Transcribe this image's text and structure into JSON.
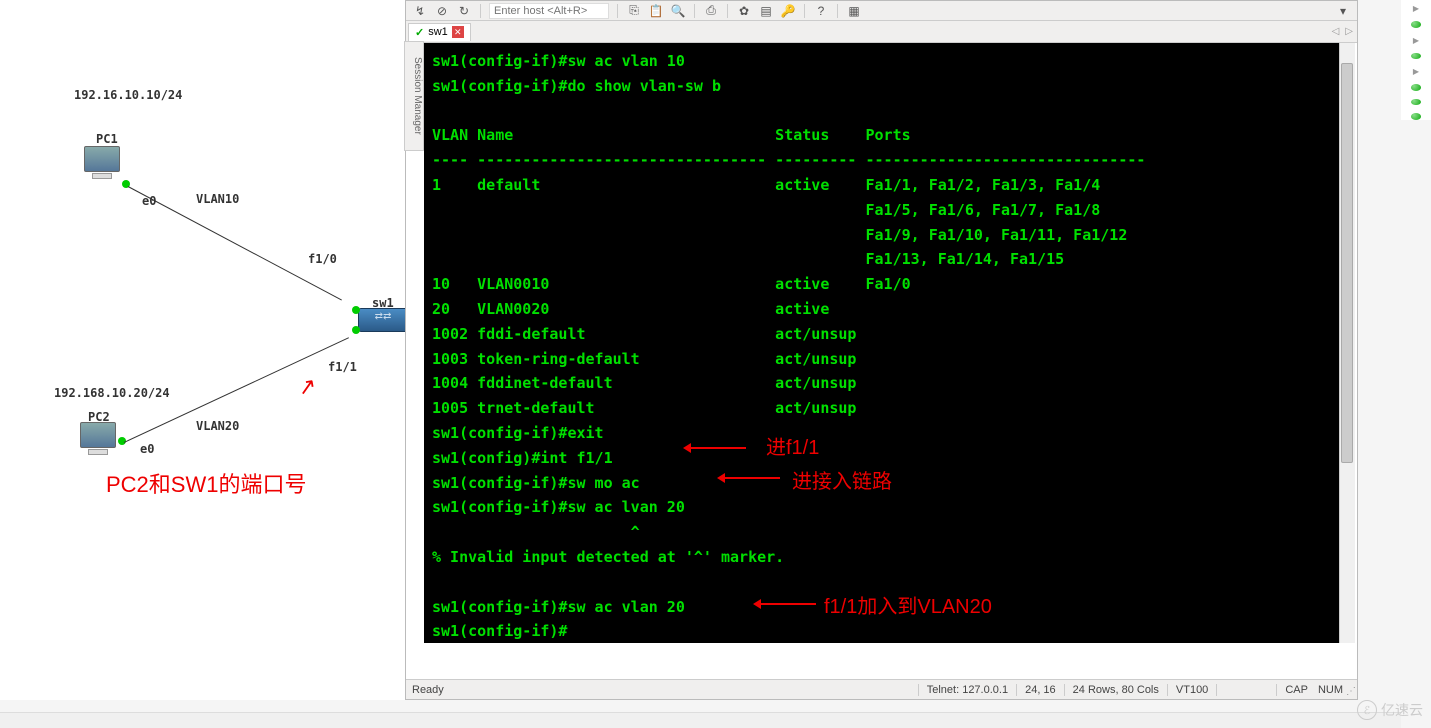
{
  "topology": {
    "subnet1": "192.16.10.10/24",
    "pc1_label": "PC1",
    "pc1_port": "e0",
    "vlan10_label": "VLAN10",
    "f10_label": "f1/0",
    "sw1_label": "sw1",
    "f11_label": "f1/1",
    "subnet2": "192.168.10.20/24",
    "pc2_label": "PC2",
    "pc2_port": "e0",
    "vlan20_label": "VLAN20",
    "annot_ports": "PC2和SW1的端口号",
    "arrow_glyph": "↗"
  },
  "toolbar": {
    "host_placeholder": "Enter host <Alt+R>"
  },
  "session_manager_tab": "Session Manager",
  "tab": {
    "name": "sw1",
    "check": "✓",
    "close": "✕"
  },
  "terminal_lines": "sw1(config-if)#sw ac vlan 10\nsw1(config-if)#do show vlan-sw b\n\nVLAN Name                             Status    Ports\n---- -------------------------------- --------- -------------------------------\n1    default                          active    Fa1/1, Fa1/2, Fa1/3, Fa1/4\n                                                Fa1/5, Fa1/6, Fa1/7, Fa1/8\n                                                Fa1/9, Fa1/10, Fa1/11, Fa1/12\n                                                Fa1/13, Fa1/14, Fa1/15\n10   VLAN0010                         active    Fa1/0\n20   VLAN0020                         active\n1002 fddi-default                     act/unsup\n1003 token-ring-default               act/unsup\n1004 fddinet-default                  act/unsup\n1005 trnet-default                    act/unsup\nsw1(config-if)#exit\nsw1(config)#int f1/1\nsw1(config-if)#sw mo ac\nsw1(config-if)#sw ac lvan 20\n                      ^\n% Invalid input detected at '^' marker.\n\nsw1(config-if)#sw ac vlan 20\nsw1(config-if)#",
  "chart_data": {
    "type": "table",
    "title": "do show vlan-sw b",
    "columns": [
      "VLAN",
      "Name",
      "Status",
      "Ports"
    ],
    "rows": [
      {
        "VLAN": 1,
        "Name": "default",
        "Status": "active",
        "Ports": "Fa1/1, Fa1/2, Fa1/3, Fa1/4, Fa1/5, Fa1/6, Fa1/7, Fa1/8, Fa1/9, Fa1/10, Fa1/11, Fa1/12, Fa1/13, Fa1/14, Fa1/15"
      },
      {
        "VLAN": 10,
        "Name": "VLAN0010",
        "Status": "active",
        "Ports": "Fa1/0"
      },
      {
        "VLAN": 20,
        "Name": "VLAN0020",
        "Status": "active",
        "Ports": ""
      },
      {
        "VLAN": 1002,
        "Name": "fddi-default",
        "Status": "act/unsup",
        "Ports": ""
      },
      {
        "VLAN": 1003,
        "Name": "token-ring-default",
        "Status": "act/unsup",
        "Ports": ""
      },
      {
        "VLAN": 1004,
        "Name": "fddinet-default",
        "Status": "act/unsup",
        "Ports": ""
      },
      {
        "VLAN": 1005,
        "Name": "trnet-default",
        "Status": "act/unsup",
        "Ports": ""
      }
    ]
  },
  "term_annots": {
    "a1": "进f1/1",
    "a2": "进接入链路",
    "a3": "f1/1加入到VLAN20"
  },
  "status": {
    "ready": "Ready",
    "conn": "Telnet: 127.0.0.1",
    "cursor": "24,  16",
    "size": "24 Rows, 80 Cols",
    "emul": "VT100",
    "cap": "CAP",
    "num": "NUM"
  },
  "watermark": "亿速云"
}
